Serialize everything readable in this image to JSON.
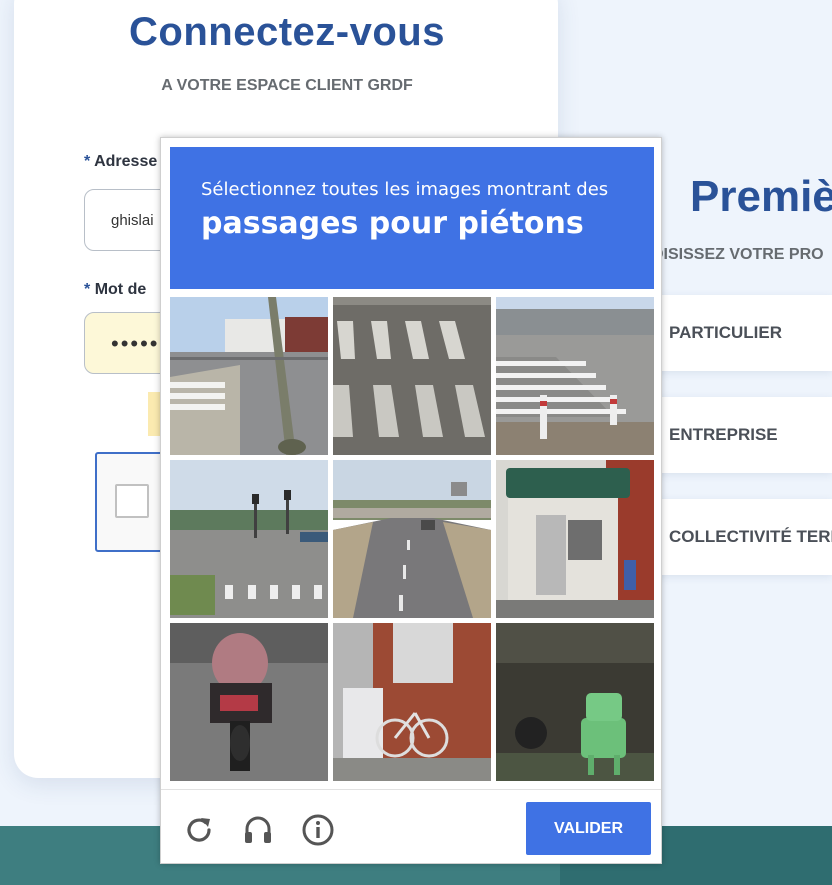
{
  "login": {
    "title": "Connectez-vous",
    "subtitle": "A VOTRE ESPACE CLIENT GRDF",
    "email_label": "Adresse",
    "email_value": "ghislai",
    "password_label": "Mot de",
    "password_value": "•••••",
    "required_mark": "*"
  },
  "right_panel": {
    "title": "Premiè",
    "subtitle": "DISISSEZ VOTRE PRO",
    "choices": [
      {
        "label": "PARTICULIER"
      },
      {
        "label": "ENTREPRISE"
      },
      {
        "label": "COLLECTIVITÉ TERI"
      }
    ]
  },
  "captcha_challenge": {
    "instruction": "Sélectionnez toutes les images montrant des",
    "target": "passages pour piétons",
    "verify_label": "VALIDER",
    "tiles": [
      {
        "index": 1,
        "scene": "street corner with pole and crosswalk"
      },
      {
        "index": 2,
        "scene": "crosswalk stripes close-up"
      },
      {
        "index": 3,
        "scene": "crosswalk with bollards"
      },
      {
        "index": 4,
        "scene": "intersection with traffic lights and crosswalk"
      },
      {
        "index": 5,
        "scene": "highway road"
      },
      {
        "index": 6,
        "scene": "small building with green awning"
      },
      {
        "index": 7,
        "scene": "motorcycle"
      },
      {
        "index": 8,
        "scene": "bicycles against brick wall"
      },
      {
        "index": 9,
        "scene": "green chair in dark yard"
      }
    ],
    "icons": [
      "reload-icon",
      "audio-icon",
      "info-icon"
    ],
    "accent_color": "#3f72e4"
  },
  "colors": {
    "brand_blue": "#2a5298",
    "band_teal": "#3e7e80"
  }
}
